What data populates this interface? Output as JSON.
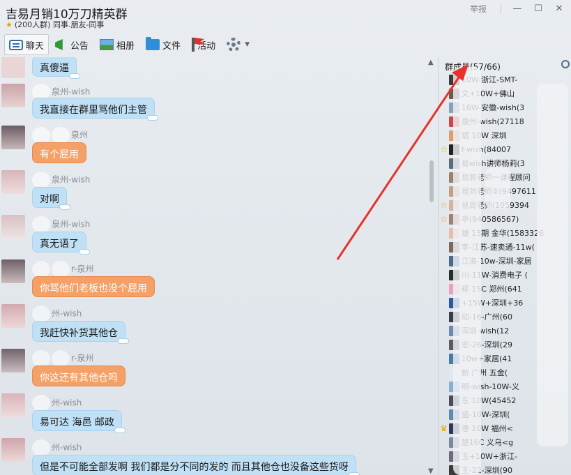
{
  "window": {
    "title": "吉易月销10万刀精英群",
    "subtitle": "(200人群) 同事.朋友-同事",
    "report_label": "举报",
    "minimize": "—",
    "maximize": "☐",
    "close": "✕"
  },
  "toolbar": {
    "chat": "聊天",
    "notice": "公告",
    "album": "相册",
    "file": "文件",
    "activity": "活动"
  },
  "messages": [
    {
      "sender": "",
      "text": "真傻逼",
      "style": "blue"
    },
    {
      "sender": "泉州-wish",
      "text": "我直接在群里骂他们主管",
      "style": "blue"
    },
    {
      "sender": "泉州",
      "text": "有个屁用",
      "style": "orange"
    },
    {
      "sender": "泉州-wish",
      "text": "对啊",
      "style": "blue"
    },
    {
      "sender": "泉州-wish",
      "text": "真无语了",
      "style": "blue"
    },
    {
      "sender": "r-泉州",
      "text": "你骂他们老板也没个屁用",
      "style": "orange"
    },
    {
      "sender": "州-wish",
      "text": "我赶快补货其他仓",
      "style": "blue"
    },
    {
      "sender": "r-泉州",
      "text": "你这还有其他仓吗",
      "style": "orange"
    },
    {
      "sender": "州-wish",
      "text": "易可达  海邑  邮政",
      "style": "blue"
    },
    {
      "sender": "州-wish",
      "text": "但是不可能全部发啊  我们都是分不同的发的  而且其他仓也没备这些货呀",
      "style": "blue"
    }
  ],
  "members": {
    "title": "群成员(57/66)",
    "list": [
      {
        "name": "10W-浙江-SMT-",
        "badge": ""
      },
      {
        "name": "文+10W+佛山",
        "badge": ""
      },
      {
        "name": "16W-安徽-wish(3",
        "badge": ""
      },
      {
        "name": "泉州-wish(27118",
        "badge": ""
      },
      {
        "name": "斌 10W 深圳",
        "badge": ""
      },
      {
        "name": "f-wish(84007",
        "badge": "star"
      },
      {
        "name": "易wish讲师杨莉(3",
        "badge": ""
      },
      {
        "name": "易郭老师一课程顾问",
        "badge": ""
      },
      {
        "name": "易刘老师②(9497611",
        "badge": ""
      },
      {
        "name": "易周老师(1059394",
        "badge": "star"
      },
      {
        "name": "亭(940586567)",
        "badge": "star"
      },
      {
        "name": "雄 13期 金华(1583326",
        "badge": ""
      },
      {
        "name": "李-江苏-速卖通-11w(",
        "badge": ""
      },
      {
        "name": "江海-10w-深圳-家居",
        "badge": ""
      },
      {
        "name": "川-11W-消费电子 (",
        "badge": ""
      },
      {
        "name": "辉 15C 郑州(641",
        "badge": ""
      },
      {
        "name": "+15W+深圳+36",
        "badge": ""
      },
      {
        "name": "动-16-广州(60",
        "badge": ""
      },
      {
        "name": "深圳 wish(12",
        "badge": ""
      },
      {
        "name": "宏-26-深圳(29",
        "badge": ""
      },
      {
        "name": "10w+家居(41",
        "badge": ""
      },
      {
        "name": "新 广州 五金(",
        "badge": ""
      },
      {
        "name": "明-wish-10W-义",
        "badge": ""
      },
      {
        "name": "东 10W(45452",
        "badge": ""
      },
      {
        "name": "盛-10W-深圳(",
        "badge": ""
      },
      {
        "name": "恩 10W 福州<",
        "badge": "crown"
      },
      {
        "name": "楚16C 义乌<g",
        "badge": ""
      },
      {
        "name": "玉+10W+浙江-",
        "badge": ""
      },
      {
        "name": "王-22-深圳(90",
        "badge": ""
      }
    ]
  },
  "colors": {
    "bubble_blue": "#bfe0f5",
    "bubble_orange": "#f4a066",
    "arrow_red": "#e8312b"
  }
}
